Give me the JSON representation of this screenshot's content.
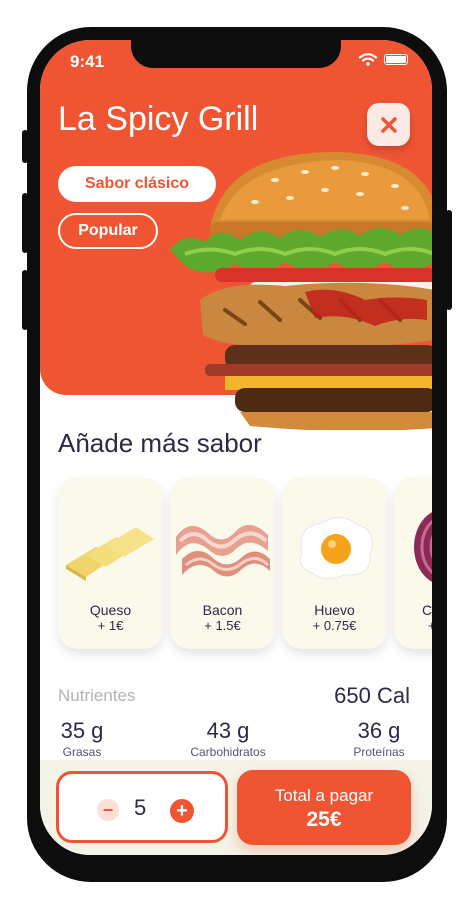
{
  "status_bar": {
    "time": "9:41"
  },
  "restaurant": {
    "title": "La Spicy Grill",
    "tags": [
      "Sabor clásico",
      "Popular"
    ]
  },
  "icons": {
    "close": "close-icon",
    "wifi": "wifi-icon",
    "battery": "battery-icon"
  },
  "extras": {
    "heading": "Añade más sabor",
    "items": [
      {
        "name": "Queso",
        "price": "+ 1€",
        "icon": "cheese-image"
      },
      {
        "name": "Bacon",
        "price": "+ 1.5€",
        "icon": "bacon-image"
      },
      {
        "name": "Huevo",
        "price": "+ 0.75€",
        "icon": "egg-image"
      },
      {
        "name": "Ce",
        "price": "+",
        "icon": "onion-image"
      }
    ]
  },
  "nutrition": {
    "label": "Nutrientes",
    "calories": "650 Cal",
    "items": [
      {
        "value": "35 g",
        "label": "Grasas"
      },
      {
        "value": "43 g",
        "label": "Carbohidratos"
      },
      {
        "value": "36 g",
        "label": "Proteínas"
      }
    ]
  },
  "order": {
    "quantity": "5",
    "minus": "−",
    "plus": "+",
    "pay_label": "Total a pagar",
    "total": "25€"
  },
  "colors": {
    "accent": "#ef5533",
    "text": "#2b2b45",
    "card_bg": "#fbf9ec"
  }
}
